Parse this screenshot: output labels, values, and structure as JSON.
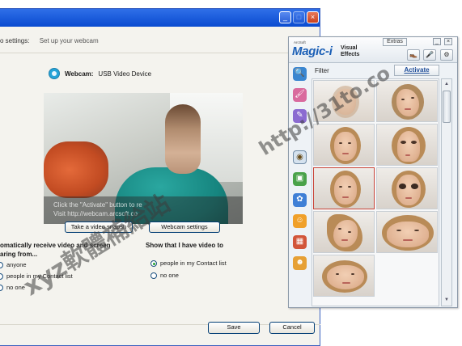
{
  "window": {
    "minimize_glyph": "_",
    "maximize_glyph": "□",
    "close_glyph": "×"
  },
  "breadcrumb": {
    "section": "o settings:",
    "current": "Set up your webcam"
  },
  "webcam": {
    "label": "Webcam:",
    "device": "USB Video Device"
  },
  "video": {
    "overlay_line1": "Click the \"Activate\" button to re",
    "overlay_line2": "Visit http://webcam.arcsoft.co"
  },
  "buttons": {
    "snapshot": "Take a video snapsh",
    "webcam_settings": "Webcam settings",
    "save": "Save",
    "cancel": "Cancel"
  },
  "receive_video": {
    "title_line1": "omatically receive video and screen",
    "title_line2": "aring from...",
    "options": [
      "anyone",
      "people in my Contact list",
      "no one"
    ],
    "selected_index": -1
  },
  "show_video": {
    "title": "Show that I have video to",
    "options": [
      "people in my Contact list",
      "no one"
    ],
    "selected_index": 0
  },
  "magic_i": {
    "vendor": "ArcSoft",
    "brand": "Magic-i",
    "subtitle": "Visual Effects",
    "extras_label": "Extras",
    "minimize_glyph": "_",
    "close_glyph": "×",
    "tool_icons": [
      "shoe-icon",
      "microphone-icon",
      "settings-icon"
    ],
    "tool_glyphs": [
      "👞",
      "🎤",
      "⚙"
    ],
    "filter_label": "Filter",
    "activate_label": "Activate",
    "categories": [
      {
        "icon": "magnifier-icon",
        "glyph": "🔍"
      },
      {
        "icon": "brush-icon",
        "glyph": "🖌"
      },
      {
        "icon": "palette-icon",
        "glyph": "✎"
      },
      {
        "icon": "face-warp-icon",
        "glyph": "◉"
      },
      {
        "icon": "frame-icon",
        "glyph": "▣"
      },
      {
        "icon": "bubbles-icon",
        "glyph": "✿"
      },
      {
        "icon": "smiley-icon",
        "glyph": "☺"
      },
      {
        "icon": "photo-icon",
        "glyph": "▦"
      },
      {
        "icon": "character-icon",
        "glyph": "☻"
      }
    ],
    "active_category_index": 3,
    "effects": [
      {
        "name": "disintegrate-effect"
      },
      {
        "name": "warp-swirl-effect"
      },
      {
        "name": "normal-face-effect"
      },
      {
        "name": "pinch-effect"
      },
      {
        "name": "normal-face-selected-effect"
      },
      {
        "name": "bug-eye-effect"
      },
      {
        "name": "twist-effect"
      },
      {
        "name": "wide-face-effect"
      },
      {
        "name": "stretch-effect"
      }
    ],
    "selected_effect_index": 4
  },
  "watermark": {
    "line1": "xyz軟體補給站",
    "line2": "http://31to.co"
  }
}
